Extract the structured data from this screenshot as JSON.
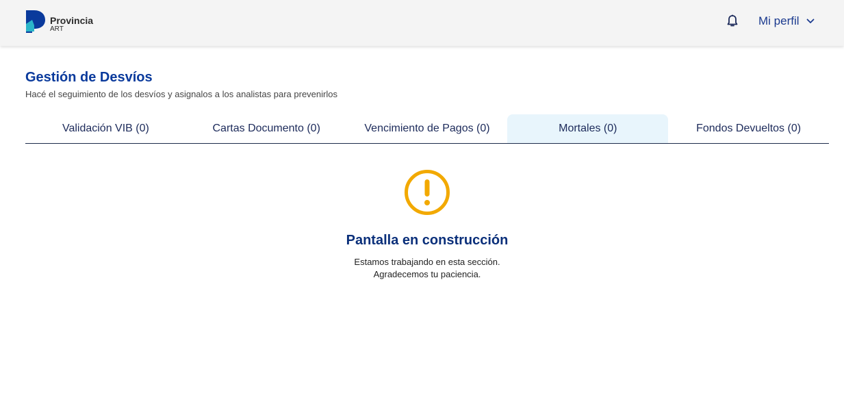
{
  "header": {
    "logo": {
      "name": "Provincia",
      "sub": "ART"
    },
    "profile_label": "Mi perfil"
  },
  "page": {
    "title": "Gestión de Desvíos",
    "subtitle": "Hacé el seguimiento de los desvíos y asignalos a los analistas para prevenirlos"
  },
  "tabs": [
    {
      "label": "Validación VIB (0)",
      "active": false
    },
    {
      "label": "Cartas Documento (0)",
      "active": false
    },
    {
      "label": "Vencimiento de Pagos (0)",
      "active": false
    },
    {
      "label": "Mortales (0)",
      "active": true
    },
    {
      "label": "Fondos Devueltos (0)",
      "active": false
    }
  ],
  "empty_state": {
    "icon": "warning-icon",
    "title": "Pantalla en construcción",
    "line1": "Estamos trabajando en esta sección.",
    "line2": "Agradecemos tu paciencia."
  },
  "colors": {
    "brand_blue": "#0a3a9c",
    "logo_teal": "#2bb5c9",
    "warning": "#f2a900",
    "active_tab_bg": "#e8f5fc"
  }
}
